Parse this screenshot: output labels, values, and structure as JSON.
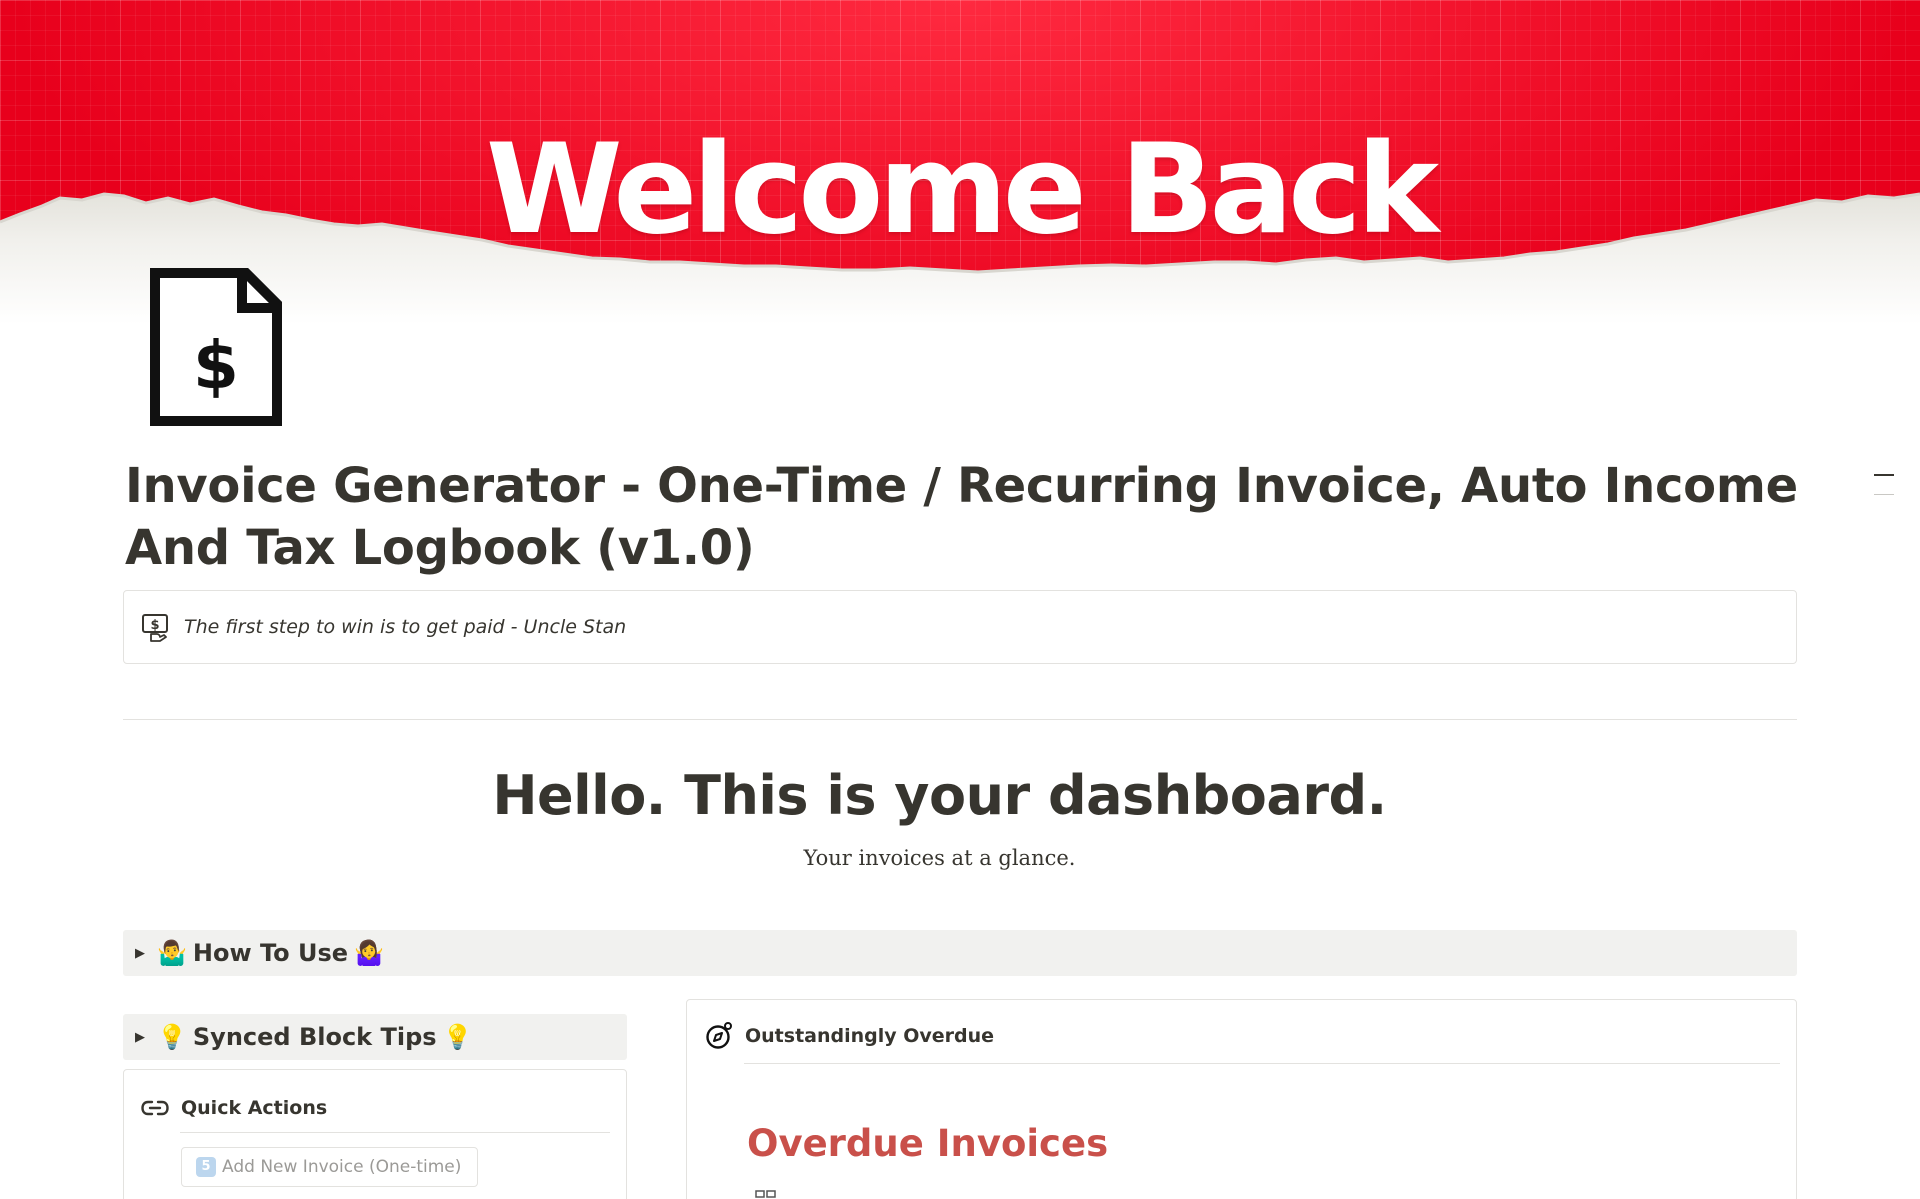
{
  "cover": {
    "title": "Welcome Back",
    "colors": {
      "red": "#ee0a24",
      "paper": "#f2f2ee"
    }
  },
  "page": {
    "icon": "invoice-dollar-document-icon",
    "title": "Invoice Generator - One-Time / Recurring Invoice, Auto Income And Tax Logbook (v1.0)"
  },
  "callout": {
    "icon": "hand-with-dollar-sign-icon",
    "text": "The first step to win is to get paid - Uncle Stan"
  },
  "dashboard": {
    "heading": "Hello. This is your dashboard.",
    "subheading": "Your invoices at a glance."
  },
  "how_to_use": {
    "arrow": "▶",
    "emoji_left": "🤷‍♂️",
    "label": "How To Use",
    "emoji_right": "🤷‍♀️"
  },
  "synced_block_tips": {
    "arrow": "▶",
    "emoji_left": "💡",
    "label": "Synced Block Tips",
    "emoji_right": "💡"
  },
  "quick_actions": {
    "icon": "link-icon",
    "label": "Quick Actions",
    "buttons": [
      {
        "badge": "5",
        "label": "Add New Invoice (One-time)"
      }
    ]
  },
  "overdue": {
    "icon": "compass-icon",
    "label": "Outstandingly Overdue",
    "section_title": "Overdue Invoices",
    "section_icon": "table-icon"
  }
}
